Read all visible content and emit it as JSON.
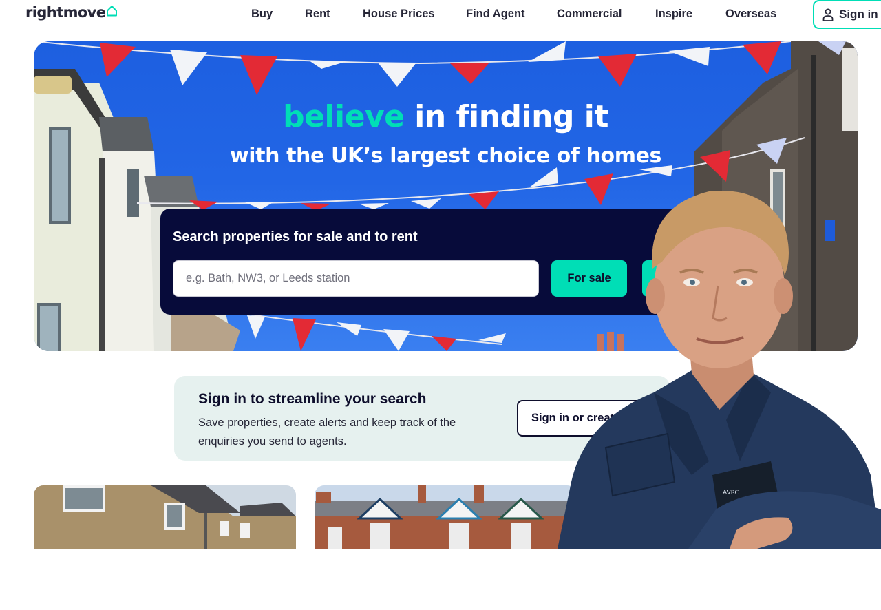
{
  "header": {
    "logo_text": "rightmove",
    "nav": [
      {
        "id": "buy",
        "label": "Buy"
      },
      {
        "id": "rent",
        "label": "Rent"
      },
      {
        "id": "house-prices",
        "label": "House Prices"
      },
      {
        "id": "find-agent",
        "label": "Find Agent"
      },
      {
        "id": "commercial",
        "label": "Commercial"
      },
      {
        "id": "inspire",
        "label": "Inspire"
      },
      {
        "id": "overseas",
        "label": "Overseas"
      }
    ],
    "signin_label": "Sign in"
  },
  "hero": {
    "title_accent": "believe",
    "title_rest": " in finding it",
    "subtitle": "with the UK’s largest choice of homes",
    "search": {
      "heading": "Search properties for sale and to rent",
      "placeholder": "e.g. Bath, NW3, or Leeds station",
      "value": "",
      "for_sale_label": "For sale",
      "to_rent_label": ""
    }
  },
  "promo": {
    "title": "Sign in to streamline your search",
    "text": "Save properties, create alerts and keep track of the enquiries you send to agents.",
    "button_label": "Sign in or create"
  },
  "colors": {
    "brand_accent": "#00deb6",
    "text_dark": "#262637",
    "search_panel": "#070b3a",
    "sky": "#2266e6",
    "promo_bg": "#e6f1ef"
  },
  "icons": {
    "logo": "house-outline-icon",
    "signin": "user-icon"
  }
}
